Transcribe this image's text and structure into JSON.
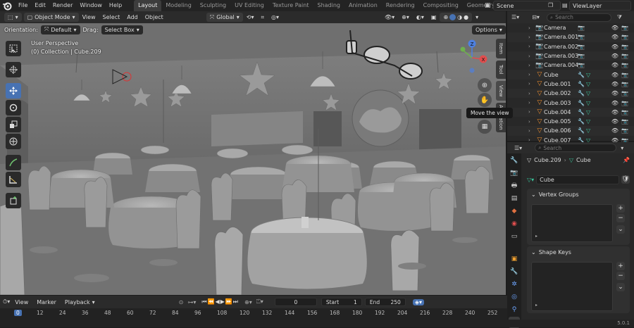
{
  "menu": {
    "file": "File",
    "edit": "Edit",
    "render": "Render",
    "window": "Window",
    "help": "Help"
  },
  "workspaces": [
    "Layout",
    "Modeling",
    "Sculpting",
    "UV Editing",
    "Texture Paint",
    "Shading",
    "Animation",
    "Rendering",
    "Compositing",
    "Geometry Node"
  ],
  "scene": "Scene",
  "view_layer": "ViewLayer",
  "viewport_header": {
    "mode": "Object Mode",
    "view": "View",
    "select": "Select",
    "add": "Add",
    "object": "Object",
    "transform_orientation": "Global"
  },
  "tool_header": {
    "orientation_label": "Orientation:",
    "orientation_value": "Default",
    "drag_label": "Drag:",
    "drag_value": "Select Box",
    "options": "Options"
  },
  "viewport_overlay": {
    "perspective": "User Perspective",
    "collection": "(0) Collection | Cube.209"
  },
  "side_tabs": [
    "Item",
    "Tool",
    "View",
    "Animation"
  ],
  "tooltip": "Move the view",
  "gizmo": {
    "x": "X",
    "y": "Y",
    "z": "Z"
  },
  "outliner": {
    "search_placeholder": "Search",
    "items": [
      {
        "name": "Camera",
        "type": "camera"
      },
      {
        "name": "Camera.001",
        "type": "camera"
      },
      {
        "name": "Camera.002",
        "type": "camera"
      },
      {
        "name": "Camera.003",
        "type": "camera"
      },
      {
        "name": "Camera.004",
        "type": "camera"
      },
      {
        "name": "Cube",
        "type": "mesh"
      },
      {
        "name": "Cube.001",
        "type": "mesh"
      },
      {
        "name": "Cube.002",
        "type": "mesh"
      },
      {
        "name": "Cube.003",
        "type": "mesh"
      },
      {
        "name": "Cube.004",
        "type": "mesh"
      },
      {
        "name": "Cube.005",
        "type": "mesh"
      },
      {
        "name": "Cube.006",
        "type": "mesh"
      },
      {
        "name": "Cube.007",
        "type": "mesh"
      }
    ]
  },
  "properties": {
    "search_placeholder": "Search",
    "object_name": "Cube.209",
    "data_name": "Cube",
    "mesh_field": "Cube",
    "vertex_groups": "Vertex Groups",
    "shape_keys": "Shape Keys"
  },
  "timeline": {
    "view": "View",
    "marker": "Marker",
    "playback": "Playback",
    "current_frame": "0",
    "start_label": "Start",
    "start": "1",
    "end_label": "End",
    "end": "250"
  },
  "ruler_ticks": [
    "0",
    "12",
    "24",
    "36",
    "48",
    "60",
    "72",
    "84",
    "96",
    "108",
    "120",
    "132",
    "144",
    "156",
    "168",
    "180",
    "192",
    "204",
    "216",
    "228",
    "240",
    "252"
  ],
  "version": "5.0.1",
  "colors": {
    "accent": "#4772b3",
    "camera": "#e88a2e",
    "mesh": "#e88a2e",
    "modifier": "#6ea6ff",
    "mesh_data": "#39c39a"
  }
}
